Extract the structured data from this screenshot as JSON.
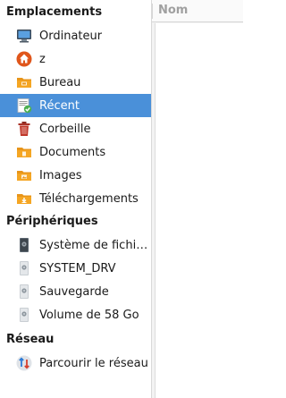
{
  "sidebar": {
    "sections": {
      "places": "Emplacements",
      "devices": "Périphériques",
      "network": "Réseau"
    },
    "places": [
      {
        "label": "Ordinateur",
        "icon": "computer-icon"
      },
      {
        "label": "z",
        "icon": "home-icon"
      },
      {
        "label": "Bureau",
        "icon": "desktop-folder-icon"
      },
      {
        "label": "Récent",
        "icon": "recent-icon",
        "selected": true
      },
      {
        "label": "Corbeille",
        "icon": "trash-icon"
      },
      {
        "label": "Documents",
        "icon": "documents-folder-icon"
      },
      {
        "label": "Images",
        "icon": "pictures-folder-icon"
      },
      {
        "label": "Téléchargements",
        "icon": "downloads-folder-icon"
      }
    ],
    "devices": [
      {
        "label": "Système de fichiers",
        "icon": "filesystem-icon"
      },
      {
        "label": "SYSTEM_DRV",
        "icon": "drive-icon"
      },
      {
        "label": "Sauvegarde",
        "icon": "drive-icon"
      },
      {
        "label": "Volume de 58 Go",
        "icon": "drive-icon"
      }
    ],
    "network": [
      {
        "label": "Parcourir le réseau",
        "icon": "network-icon"
      }
    ]
  },
  "file_list": {
    "column_name": "Nom"
  },
  "colors": {
    "selection": "#4a90d9",
    "folder": "#f5a623",
    "home": "#e0561b",
    "trash": "#c0392b"
  }
}
